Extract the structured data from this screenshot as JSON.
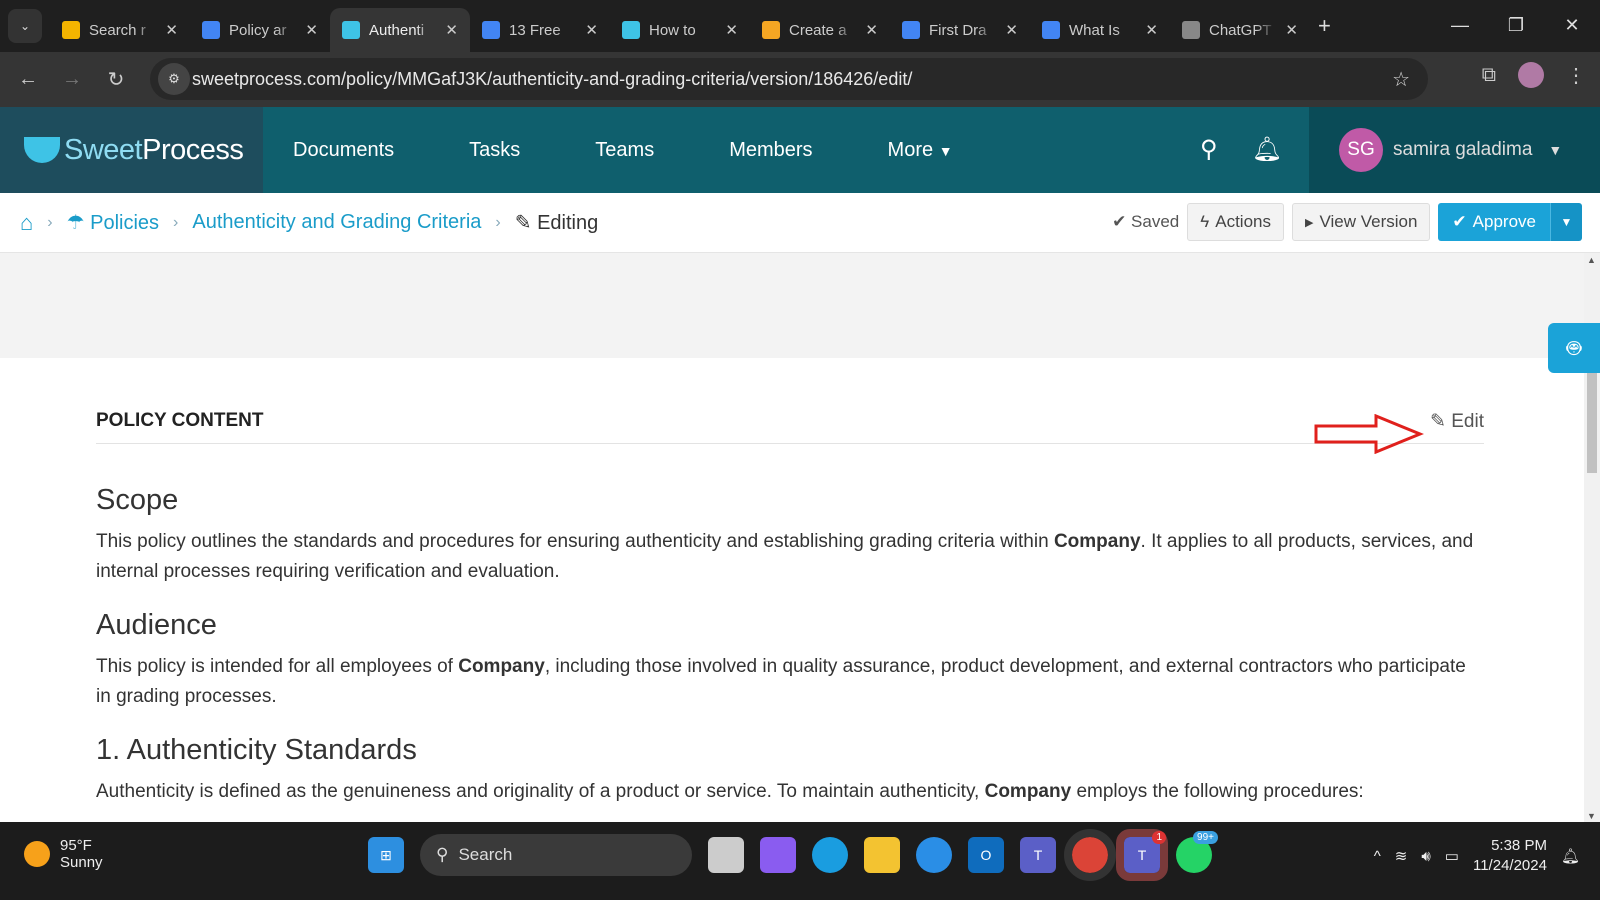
{
  "browser": {
    "tabs": [
      {
        "title": "Search r",
        "icon": "google-drive-icon",
        "color": "#f4b400"
      },
      {
        "title": "Policy ar",
        "icon": "google-docs-icon",
        "color": "#4285f4"
      },
      {
        "title": "Authenti",
        "icon": "sweetprocess-icon",
        "color": "#3ec3e6",
        "active": true
      },
      {
        "title": "13 Free",
        "icon": "google-docs-icon",
        "color": "#4285f4"
      },
      {
        "title": "How to",
        "icon": "sweetprocess-icon",
        "color": "#3ec3e6"
      },
      {
        "title": "Create a",
        "icon": "app-icon",
        "color": "#f5a623"
      },
      {
        "title": "First Dra",
        "icon": "google-docs-icon",
        "color": "#4285f4"
      },
      {
        "title": "What Is",
        "icon": "google-docs-icon",
        "color": "#4285f4"
      },
      {
        "title": "ChatGPT",
        "icon": "chatgpt-icon",
        "color": "#888888"
      }
    ],
    "url": "sweetprocess.com/policy/MMGafJ3K/authenticity-and-grading-criteria/version/186426/edit/"
  },
  "header": {
    "logo_sweet": "Sweet",
    "logo_process": "Process",
    "nav": [
      "Documents",
      "Tasks",
      "Teams",
      "Members",
      "More"
    ],
    "user_initials": "SG",
    "user_name": "samira galadima"
  },
  "breadcrumb": {
    "policies": "Policies",
    "policy": "Authenticity and Grading Criteria",
    "editing": "Editing"
  },
  "toolbar": {
    "saved": "Saved",
    "actions": "Actions",
    "view_version": "View Version",
    "approve": "Approve"
  },
  "colors": {
    "brand": "#0f5f6d",
    "accent": "#1ba3d8"
  },
  "content": {
    "section_title": "POLICY CONTENT",
    "edit": "Edit",
    "scope_h": "Scope",
    "scope_p1": "This policy outlines the standards and procedures for ensuring authenticity and establishing grading criteria within ",
    "company": "Company",
    "scope_p2": ". It applies to all products, services, and internal processes requiring verification and evaluation.",
    "audience_h": "Audience",
    "aud_p1": "This policy is intended for all employees of ",
    "aud_p2": ", including those involved in quality assurance, product development, and external contractors who participate in grading processes.",
    "auth_h": "1. Authenticity Standards",
    "auth_p1": "Authenticity is defined as the genuineness and originality of a product or service. To maintain authenticity, ",
    "auth_p2": " employs the following procedures:"
  },
  "taskbar": {
    "temp": "95°F",
    "weather": "Sunny",
    "search": "Search",
    "time": "5:38 PM",
    "date": "11/24/2024",
    "teams_badge": "1",
    "whatsapp_badge": "99+"
  }
}
